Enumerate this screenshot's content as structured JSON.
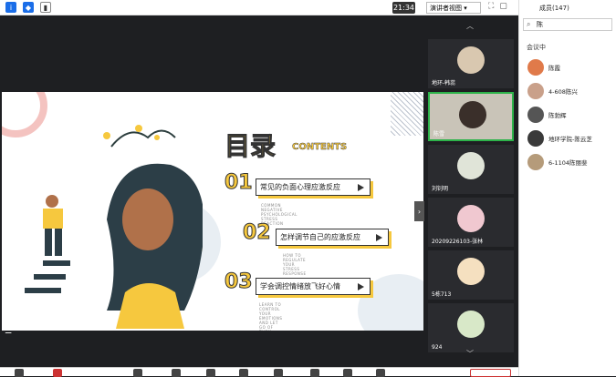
{
  "topbar": {
    "time": "21:34",
    "view_label": "演讲者视图 ▾"
  },
  "slide": {
    "title": "目录",
    "title_en": "CONTENTS",
    "items": [
      {
        "num": "01",
        "text": "常见的负面心理应激反应",
        "sub": "COMMON NEGATIVE PSYCHOLOGICAL STRESS REACTION"
      },
      {
        "num": "02",
        "text": "怎样调节自己的应激反应",
        "sub": "HOW TO REGULATE YOUR STRESS RESPONSE"
      },
      {
        "num": "03",
        "text": "学会调控情绪放飞好心情",
        "sub": "LEARN TO CONTROL YOUR EMOTIONS AND LET GO OF THEM"
      }
    ]
  },
  "participants_strip": [
    {
      "name": "地环-韩蕊"
    },
    {
      "name": "陈雪"
    },
    {
      "name": "刘钊明"
    },
    {
      "name": "20209226103-张林"
    },
    {
      "name": "5栋713"
    },
    {
      "name": "924"
    }
  ],
  "panel": {
    "title": "成员(147)",
    "search_value": "陈",
    "section": "会议中",
    "members": [
      {
        "name": "陈霞",
        "color": "#e07a4a"
      },
      {
        "name": "4-608陈兴",
        "color": "#c9a08a"
      },
      {
        "name": "陈勃辉",
        "color": "#555555"
      },
      {
        "name": "地环学院-陈云芝",
        "color": "#3a3a3a"
      },
      {
        "name": "6-1104陈丽斐",
        "color": "#b59b7a"
      }
    ]
  }
}
